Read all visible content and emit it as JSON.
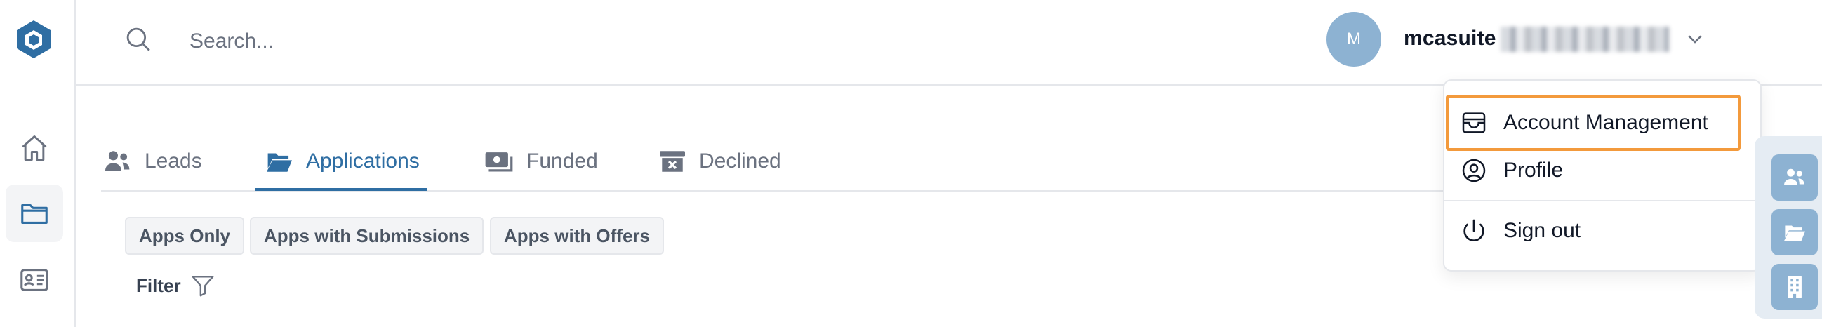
{
  "topbar": {
    "search_placeholder": "Search...",
    "avatar_initial": "M",
    "username": "mcasuite"
  },
  "tabs": [
    {
      "label": "Leads",
      "icon": "users-icon",
      "active": false
    },
    {
      "label": "Applications",
      "icon": "folder-open-icon",
      "active": true
    },
    {
      "label": "Funded",
      "icon": "money-icon",
      "active": false
    },
    {
      "label": "Declined",
      "icon": "archive-x-icon",
      "active": false
    }
  ],
  "filters": {
    "chips": [
      "Apps Only",
      "Apps with Submissions",
      "Apps with Offers"
    ],
    "filter_label": "Filter"
  },
  "user_menu": {
    "items": [
      {
        "label": "Account Management",
        "icon": "wallet-icon"
      },
      {
        "label": "Profile",
        "icon": "user-circle-icon"
      },
      {
        "label": "Sign out",
        "icon": "power-icon"
      }
    ]
  },
  "colors": {
    "accent": "#2f6ea3",
    "highlight": "#f39a3c",
    "avatar": "#8db2d2"
  }
}
